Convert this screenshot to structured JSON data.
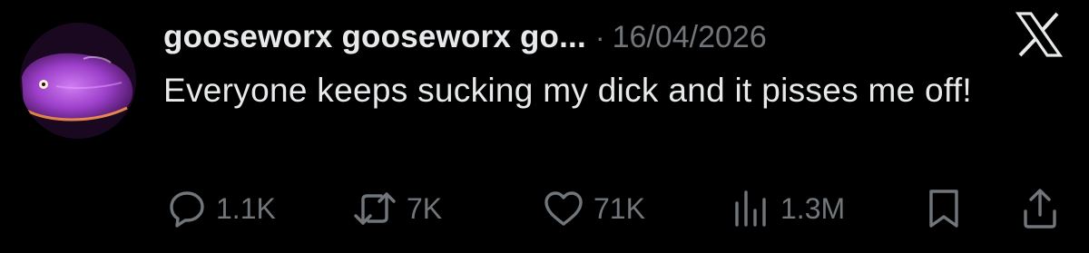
{
  "author": {
    "display_name": "gooseworx gooseworx go...",
    "separator": "·",
    "date": "16/04/2026"
  },
  "tweet": {
    "text": "Everyone keeps sucking my dick and it pisses me off!"
  },
  "metrics": {
    "replies": "1.1K",
    "reposts": "7K",
    "likes": "71K",
    "views": "1.3M"
  },
  "icons": {
    "platform_logo": "x-logo-icon",
    "reply": "speech-bubble-icon",
    "repost": "repost-arrows-icon",
    "like": "heart-icon",
    "views": "bar-chart-icon",
    "bookmark": "bookmark-icon",
    "share": "share-upload-icon"
  },
  "colors": {
    "background": "#000000",
    "text_primary": "#e7e9ea",
    "text_secondary": "#71767b",
    "avatar_accent": "#b45ee0"
  }
}
